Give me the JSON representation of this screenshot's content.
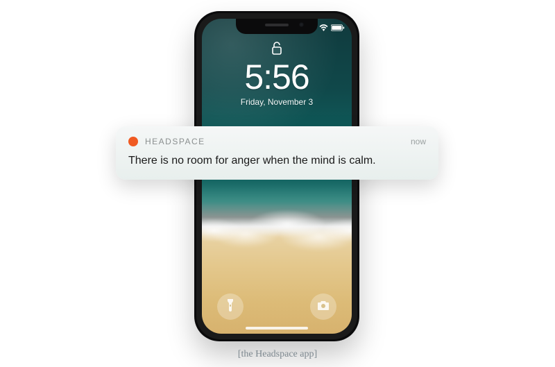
{
  "lockscreen": {
    "time": "5:56",
    "date": "Friday, November 3"
  },
  "status": {
    "airplane": true,
    "wifi": true,
    "battery": true
  },
  "notification": {
    "app_name": "HEADSPACE",
    "timestamp": "now",
    "message": "There is no room for anger when the mind is calm.",
    "accent_color": "#f05a22"
  },
  "shortcuts": {
    "left": "flashlight",
    "right": "camera"
  },
  "caption": "[the Headspace app]"
}
